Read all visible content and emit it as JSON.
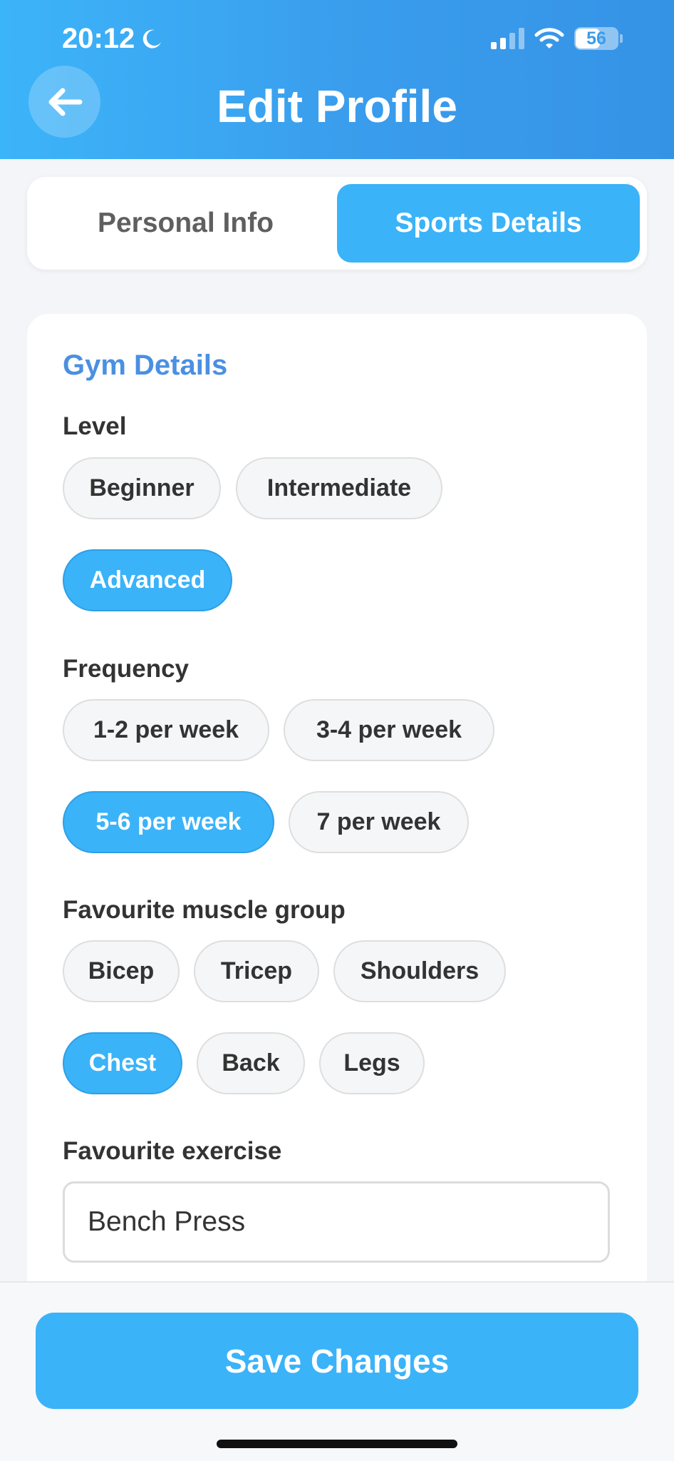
{
  "status_bar": {
    "time": "20:12",
    "battery": "56"
  },
  "header": {
    "title": "Edit Profile",
    "back_icon": "arrow-left-icon"
  },
  "tabs": [
    {
      "label": "Personal Info",
      "active": false
    },
    {
      "label": "Sports Details",
      "active": true
    }
  ],
  "gym_details": {
    "title": "Gym Details",
    "level": {
      "label": "Level",
      "options": [
        "Beginner",
        "Intermediate",
        "Advanced"
      ],
      "selected": "Advanced"
    },
    "frequency": {
      "label": "Frequency",
      "options": [
        "1-2 per week",
        "3-4 per week",
        "5-6 per week",
        "7 per week"
      ],
      "selected": "5-6 per week"
    },
    "muscle_group": {
      "label": "Favourite muscle group",
      "options": [
        "Bicep",
        "Tricep",
        "Shoulders",
        "Chest",
        "Back",
        "Legs"
      ],
      "selected": "Chest"
    },
    "favourite_exercise": {
      "label": "Favourite exercise",
      "value": "Bench Press"
    }
  },
  "actions": {
    "save_label": "Save Changes"
  },
  "colors": {
    "accent": "#3ab3f9",
    "header_start": "#3cb4f9",
    "header_end": "#3593e6",
    "section_title": "#4a90e2"
  }
}
